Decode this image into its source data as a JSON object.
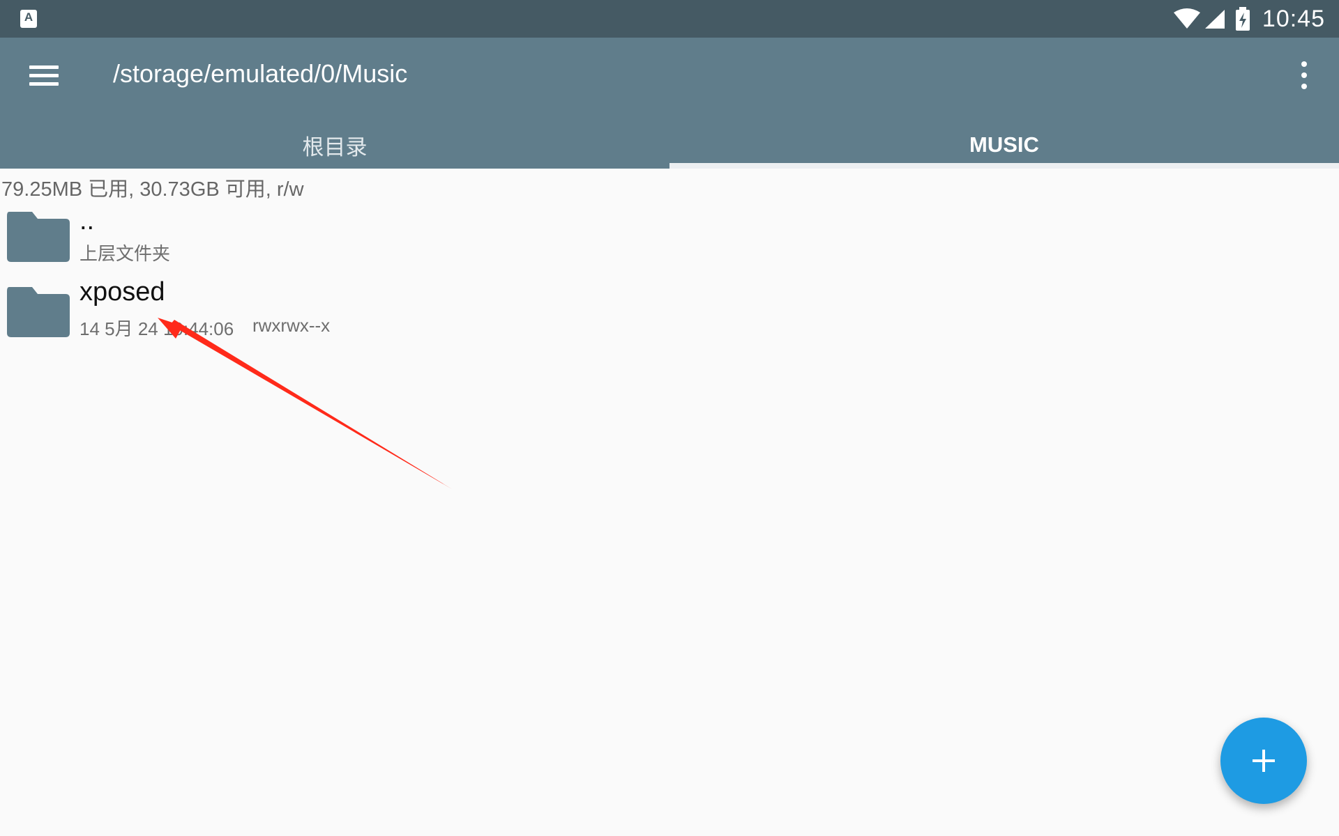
{
  "status_bar": {
    "app_icon_letter": "A",
    "time": "10:45",
    "icons": [
      "wifi-icon",
      "signal-icon",
      "battery-charging-icon"
    ]
  },
  "toolbar": {
    "menu_icon": "hamburger-menu-icon",
    "path": "/storage/emulated/0/Music",
    "overflow_icon": "more-vertical-icon"
  },
  "tabs": [
    {
      "label": "根目录",
      "active": false
    },
    {
      "label": "MUSIC",
      "active": true
    }
  ],
  "storage_info": "79.25MB 已用, 30.73GB 可用, r/w",
  "files": [
    {
      "name": "..",
      "subtitle": "上层文件夹",
      "permissions": "",
      "icon": "folder-icon"
    },
    {
      "name": "xposed",
      "subtitle": "14 5月 24 10:44:06",
      "permissions": "rwxrwx--x",
      "icon": "folder-icon"
    }
  ],
  "fab": {
    "icon": "plus-icon"
  },
  "colors": {
    "status_bar": "#455a64",
    "toolbar": "#607d8b",
    "folder": "#607d8b",
    "fab": "#1e9be3",
    "annotation_arrow": "#ff2a1a"
  }
}
